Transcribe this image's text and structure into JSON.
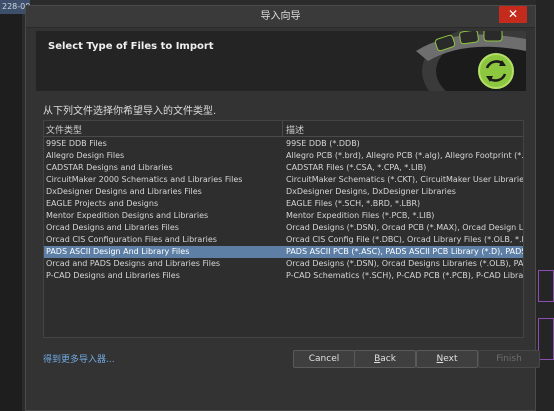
{
  "background": {
    "tab_label": "228-00"
  },
  "dialog": {
    "title": "导入向导",
    "close_glyph": "✕",
    "banner_title": "Select Type of Files to Import",
    "instruction": "从下列文件选择你希望导入的文件类型.",
    "list": {
      "header_type": "文件类型",
      "header_desc": "描述",
      "selected_index": 9,
      "rows": [
        {
          "type": "99SE DDB Files",
          "desc": "99SE DDB (*.DDB)"
        },
        {
          "type": "Allegro Design Files",
          "desc": "Allegro PCB (*.brd), Allegro PCB (*.alg), Allegro Footprint (*.dra)"
        },
        {
          "type": "CADSTAR Designs and Libraries",
          "desc": "CADSTAR Files (*.CSA, *.CPA, *.LIB)"
        },
        {
          "type": "CircuitMaker 2000 Schematics and Libraries Files",
          "desc": "CircuitMaker Schematics (*.CKT), CircuitMaker User Libraries (*.LIB)"
        },
        {
          "type": "DxDesigner Designs and Libraries Files",
          "desc": "DxDesigner Designs, DxDesigner Libraries"
        },
        {
          "type": "EAGLE Projects and Designs",
          "desc": "EAGLE Files (*.SCH, *.BRD, *.LBR)"
        },
        {
          "type": "Mentor Expedition Designs and Libraries",
          "desc": "Mentor Expedition Files (*.PCB, *.LIB)"
        },
        {
          "type": "Orcad Designs and Libraries Files",
          "desc": "Orcad Designs (*.DSN), Orcad PCB (*.MAX), Orcad Design Library (*.OLB)"
        },
        {
          "type": "Orcad CIS Configuration Files and Libraries",
          "desc": "Orcad CIS Config File (*.DBC), Orcad Library Files (*.OLB, *.LLB)"
        },
        {
          "type": "PADS ASCII Design And Library Files",
          "desc": "PADS ASCII PCB (*.ASC), PADS ASCII PCB Library (*.D), PADS ASCII Schematic"
        },
        {
          "type": "Orcad and PADS Designs and Libraries Files",
          "desc": "Orcad Designs (*.DSN), Orcad Designs Libraries (*.OLB), PADS ASCII"
        },
        {
          "type": "P-CAD Designs and Libraries Files",
          "desc": "P-CAD Schematics (*.SCH), P-CAD PCB (*.PCB), P-CAD Libraries (*.LIB)"
        }
      ]
    },
    "more_link": "得到更多导入器...",
    "buttons": {
      "cancel": "Cancel",
      "back_mnemonic": "B",
      "back_rest": "ack",
      "next_mnemonic": "N",
      "next_rest": "ext",
      "finish": "Finish"
    },
    "icons": {
      "banner_art": "sync-arrows-icon"
    },
    "colors": {
      "accent_green": "#8dc63f",
      "selection": "#5d7fa6",
      "close_red": "#c42b1c",
      "link": "#6fa8e0"
    }
  }
}
